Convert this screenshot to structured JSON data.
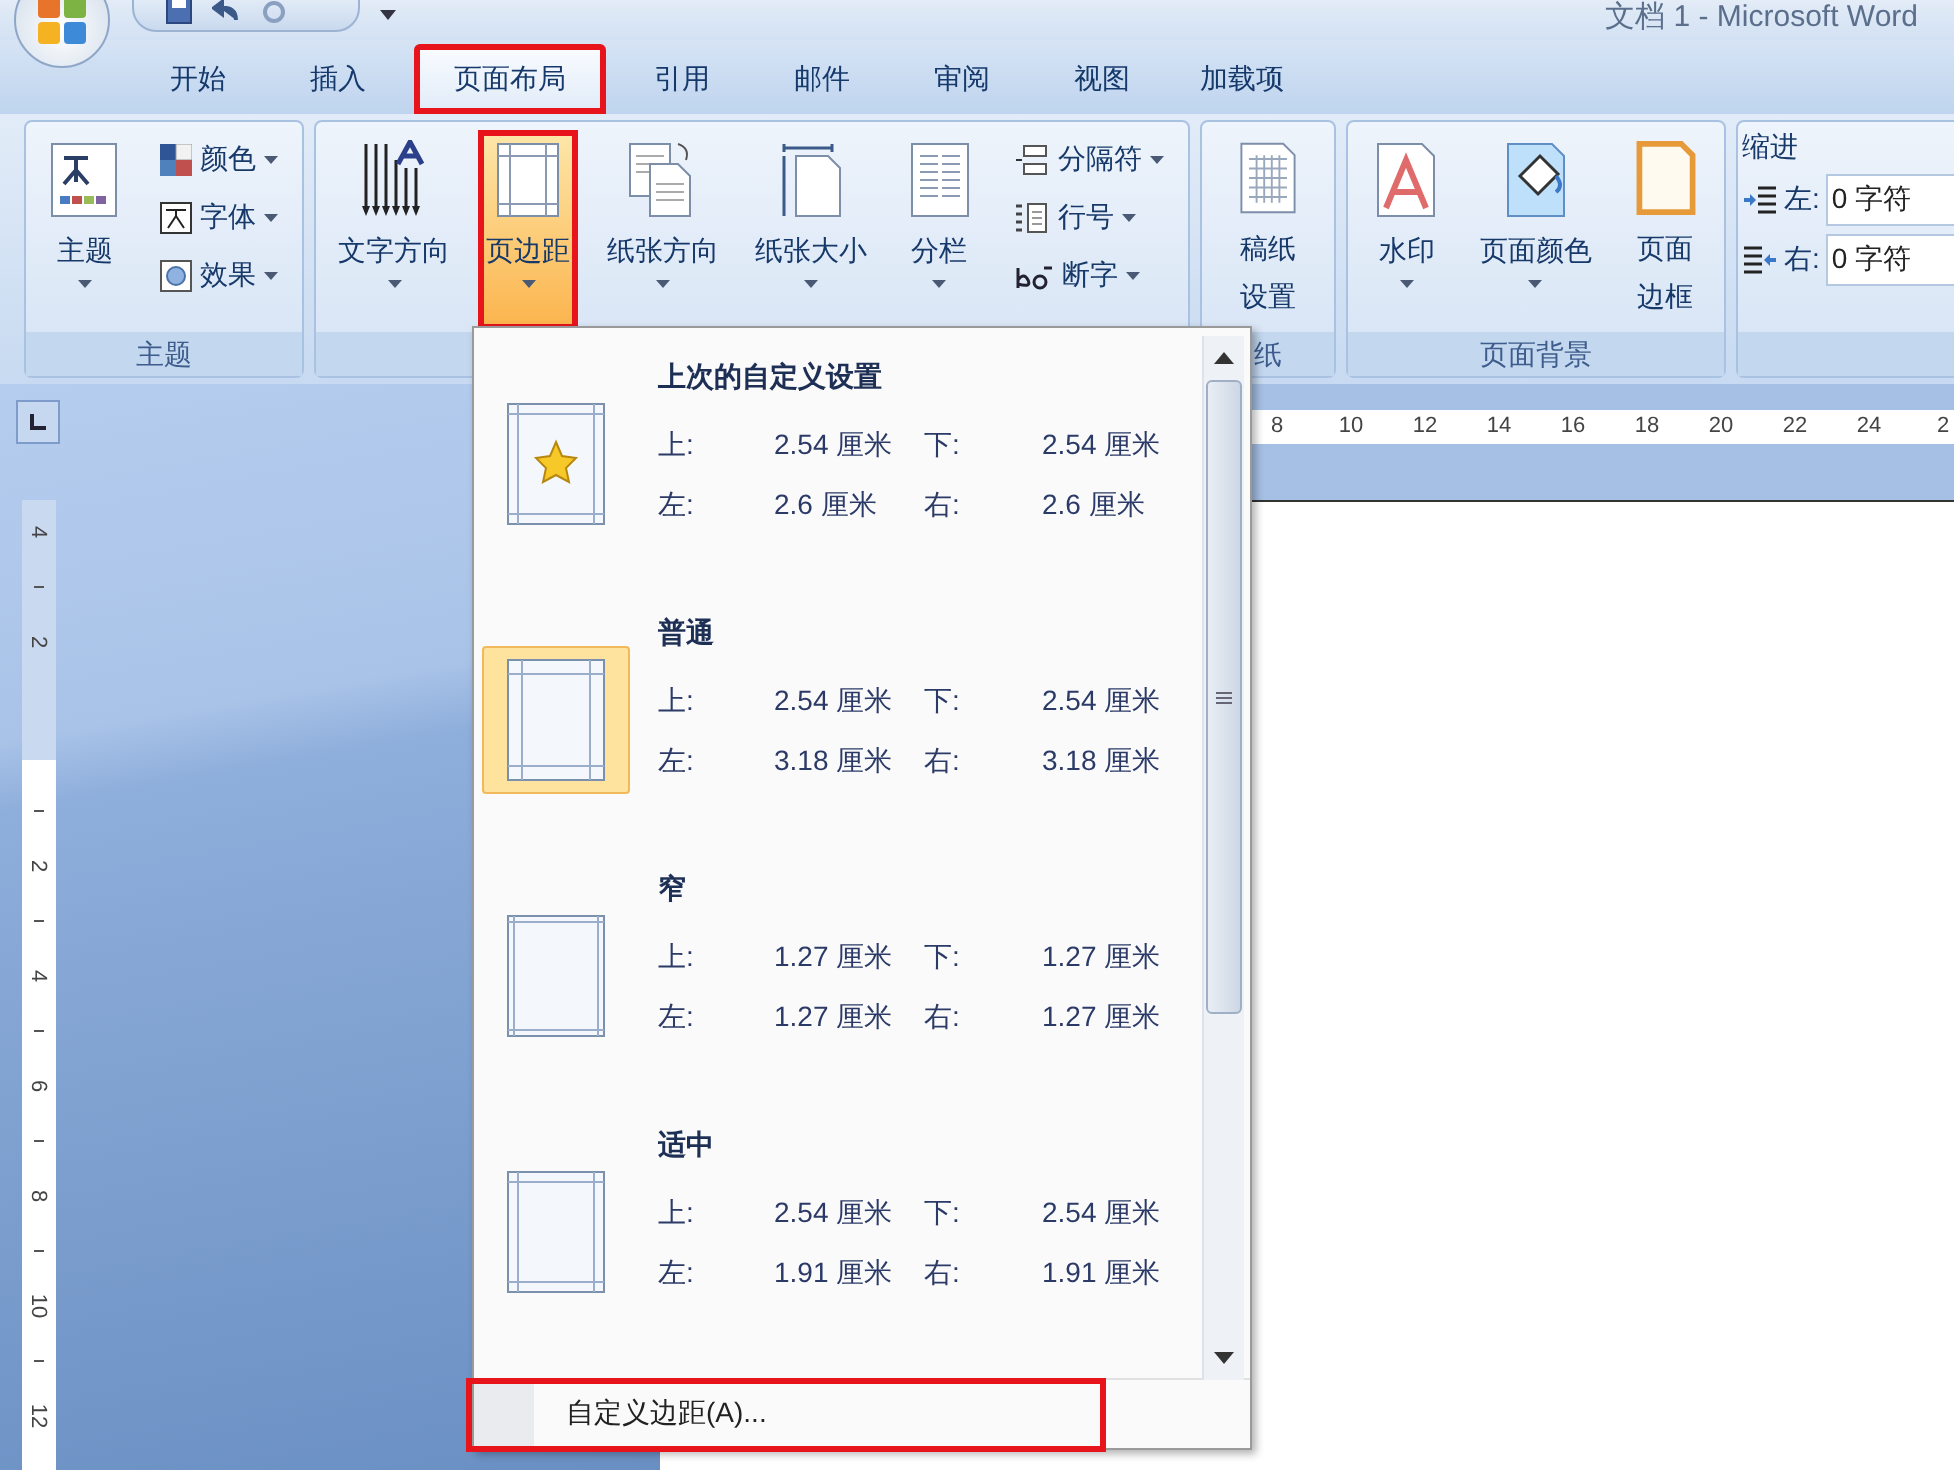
{
  "window": {
    "title": "文档 1 - Microsoft Word"
  },
  "tabs": [
    {
      "label": "开始",
      "selected": false,
      "highlighted": false
    },
    {
      "label": "插入",
      "selected": false,
      "highlighted": false
    },
    {
      "label": "页面布局",
      "selected": true,
      "highlighted": true
    },
    {
      "label": "引用",
      "selected": false,
      "highlighted": false
    },
    {
      "label": "邮件",
      "selected": false,
      "highlighted": false
    },
    {
      "label": "审阅",
      "selected": false,
      "highlighted": false
    },
    {
      "label": "视图",
      "selected": false,
      "highlighted": false
    },
    {
      "label": "加载项",
      "selected": false,
      "highlighted": false
    }
  ],
  "ribbon_groups": [
    {
      "label": "主题",
      "controls": [
        {
          "kind": "large",
          "label": "主题",
          "dropdown": true
        },
        {
          "kind": "stack",
          "items": [
            {
              "label": "颜色",
              "dropdown": true
            },
            {
              "label": "字体",
              "dropdown": true
            },
            {
              "label": "效果",
              "dropdown": true
            }
          ]
        }
      ]
    },
    {
      "controls": [
        {
          "kind": "large",
          "label": "文字方向",
          "dropdown": true
        },
        {
          "kind": "large",
          "label": "页边距",
          "dropdown": true,
          "pressed": true,
          "highlighted": true
        },
        {
          "kind": "large",
          "label": "纸张方向",
          "dropdown": true
        },
        {
          "kind": "large",
          "label": "纸张大小",
          "dropdown": true
        },
        {
          "kind": "large",
          "label": "分栏",
          "dropdown": true
        },
        {
          "kind": "stack",
          "items": [
            {
              "label": "分隔符",
              "dropdown": true
            },
            {
              "label": "行号",
              "dropdown": true
            },
            {
              "label": "断字",
              "dropdown": true
            }
          ]
        }
      ]
    },
    {
      "label": "纸",
      "controls": [
        {
          "kind": "large-wrapped",
          "label": "稿纸设置",
          "dropdown": false
        }
      ]
    },
    {
      "label": "页面背景",
      "controls": [
        {
          "kind": "large",
          "label": "水印",
          "dropdown": true
        },
        {
          "kind": "large",
          "label": "页面颜色",
          "dropdown": true
        },
        {
          "kind": "large-wrapped",
          "label": "页面边框",
          "dropdown": false
        }
      ]
    },
    {
      "controls": [
        {
          "kind": "indent",
          "heading": "缩进",
          "fields": [
            {
              "label": "左:",
              "value": "0 字符"
            },
            {
              "label": "右:",
              "value": "0 字符"
            }
          ]
        }
      ]
    }
  ],
  "horizontal_ruler": {
    "labels": [
      "8",
      "10",
      "12",
      "14",
      "16",
      "18",
      "20",
      "22",
      "24",
      "2"
    ]
  },
  "vertical_ruler": {
    "top_labels": [
      "4",
      "2"
    ],
    "labels": [
      "2",
      "4",
      "6",
      "8",
      "10",
      "12"
    ]
  },
  "margins_menu": {
    "presets": [
      {
        "name": "上次的自定义设置",
        "selected": false,
        "margins": [
          {
            "label": "上:",
            "value": "2.54 厘米"
          },
          {
            "label": "下:",
            "value": "2.54 厘米"
          },
          {
            "label": "左:",
            "value": "2.6 厘米"
          },
          {
            "label": "右:",
            "value": "2.6 厘米"
          }
        ]
      },
      {
        "name": "普通",
        "selected": true,
        "margins": [
          {
            "label": "上:",
            "value": "2.54 厘米"
          },
          {
            "label": "下:",
            "value": "2.54 厘米"
          },
          {
            "label": "左:",
            "value": "3.18 厘米"
          },
          {
            "label": "右:",
            "value": "3.18 厘米"
          }
        ]
      },
      {
        "name": "窄",
        "selected": false,
        "margins": [
          {
            "label": "上:",
            "value": "1.27 厘米"
          },
          {
            "label": "下:",
            "value": "1.27 厘米"
          },
          {
            "label": "左:",
            "value": "1.27 厘米"
          },
          {
            "label": "右:",
            "value": "1.27 厘米"
          }
        ]
      },
      {
        "name": "适中",
        "selected": false,
        "margins": [
          {
            "label": "上:",
            "value": "2.54 厘米"
          },
          {
            "label": "下:",
            "value": "2.54 厘米"
          },
          {
            "label": "左:",
            "value": "1.91 厘米"
          },
          {
            "label": "右:",
            "value": "1.91 厘米"
          }
        ]
      }
    ],
    "footer": {
      "label": "自定义边距(A)...",
      "highlighted": true
    }
  }
}
